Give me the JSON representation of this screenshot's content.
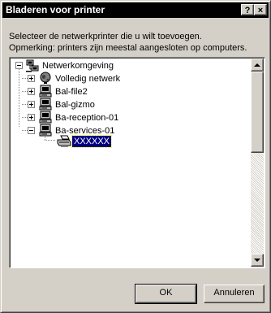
{
  "window": {
    "title": "Bladeren voor printer",
    "help_label": "?",
    "close_label": "×"
  },
  "intro": {
    "line1": "Selecteer de netwerkprinter die u wilt toevoegen.",
    "line2": "Opmerking: printers zijn meestal aangesloten op computers."
  },
  "tree": {
    "root": {
      "label": "Netwerkomgeving",
      "icon": "network-neighborhood-icon",
      "expanded": true
    },
    "children": [
      {
        "label": "Volledig netwerk",
        "icon": "globe-icon",
        "expanded": false
      },
      {
        "label": "Bal-file2",
        "icon": "computer-icon",
        "expanded": false
      },
      {
        "label": "Bal-gizmo",
        "icon": "computer-icon",
        "expanded": false
      },
      {
        "label": "Ba-reception-01",
        "icon": "computer-icon",
        "expanded": false
      },
      {
        "label": "Ba-services-01",
        "icon": "computer-icon",
        "expanded": true
      }
    ],
    "selected_printer": {
      "label": "XXXXXX",
      "icon": "printer-icon",
      "selected": true
    }
  },
  "buttons": {
    "ok": "OK",
    "cancel": "Annuleren"
  },
  "colors": {
    "face": "#d4d0c8",
    "titlebar": "#000000",
    "selection": "#000080"
  }
}
